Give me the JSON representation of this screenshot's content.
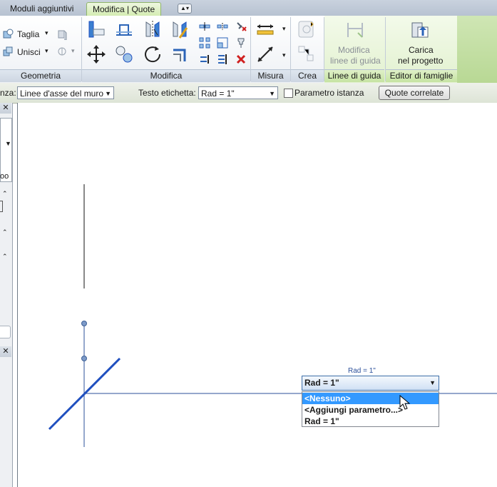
{
  "tabs": [
    {
      "label": "Moduli aggiuntivi",
      "active": false
    },
    {
      "label": "Modifica | Quote",
      "active": true
    }
  ],
  "ribbon": {
    "geometria": {
      "taglia": "Taglia",
      "unisci": "Unisci",
      "panel": "Geometria"
    },
    "modifica": {
      "panel": "Modifica"
    },
    "misura": {
      "panel": "Misura"
    },
    "crea": {
      "panel": "Crea"
    },
    "linee_guida": {
      "button_line1": "Modifica",
      "button_line2": "linee di guida",
      "panel": "Linee di guida"
    },
    "editor": {
      "button_line1": "Carica",
      "button_line2": "nel progetto",
      "panel": "Editor di famiglie"
    }
  },
  "options_bar": {
    "instance_label_fragment": "nza:",
    "instance_value": "Linee d'asse del muro",
    "label_text_caption": "Testo etichetta:",
    "label_text_value": "Rad = 1\"",
    "instance_param_label": "Parametro istanza",
    "instance_param_checked": false,
    "related_dims_button": "Quote correlate"
  },
  "left_pane": {
    "fragment_oo": "oo"
  },
  "canvas": {
    "dimension_label": "Rad = 1\"",
    "dropdown": {
      "selected": "Rad = 1\"",
      "options": [
        "<Nessuno>",
        "<Aggiungi parametro...>",
        "Rad = 1\""
      ],
      "highlighted_index": 0
    }
  },
  "colors": {
    "accent_tab": "#d4ecb2",
    "selection": "#3399ff",
    "line_blue": "#1f4fbf"
  }
}
